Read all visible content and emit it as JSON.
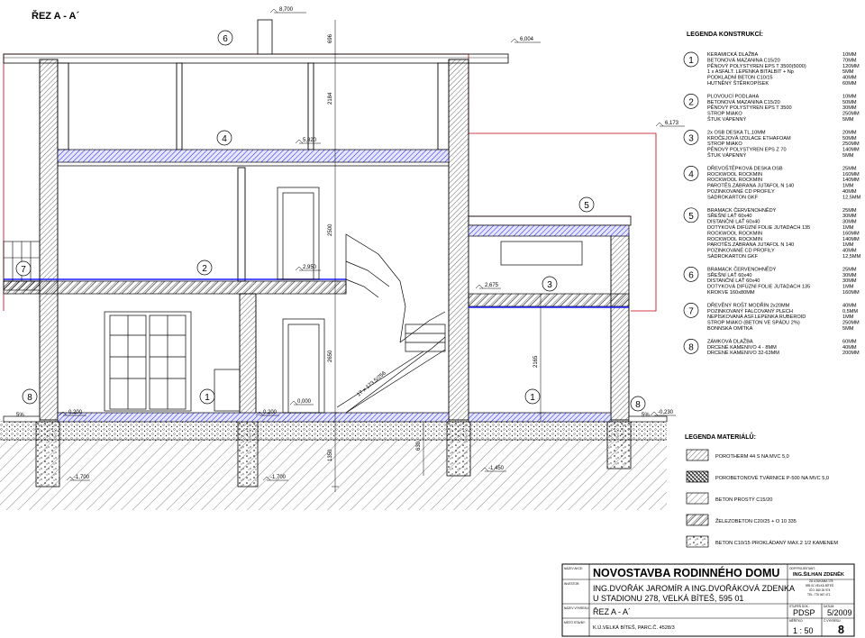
{
  "section": {
    "title": "ŘEZ  A - A´"
  },
  "levels": {
    "ridge": "8,700",
    "eave_top": "6,004",
    "side_roof": "6,173",
    "attic_floor": "5,820",
    "upper_floor": "2,950",
    "side_floor": "2,675",
    "ground": "0,000",
    "ground_left": "0,200",
    "ground_mid": "0,200",
    "terrain_right": "-0,230",
    "foot_left": "-1,700",
    "foot_mid": "-1,700",
    "foot_right": "-1,450"
  },
  "dims": {
    "d1": "696",
    "d2": "2184",
    "d3": "2500",
    "d4": "2650",
    "d5": "2165",
    "d6": "630",
    "d7": "1350",
    "stair": "17 x 173,5/256"
  },
  "slope": {
    "left": "5%",
    "right": "5%"
  },
  "section_markers": [
    "1",
    "2",
    "3",
    "4",
    "5",
    "6",
    "7",
    "8"
  ],
  "legend": {
    "title": "LEGENDA KONSTRUKCÍ:",
    "items": [
      {
        "num": "1",
        "lines": [
          {
            "name": "KERAMICKÁ DLAŽBA",
            "val": "10MM"
          },
          {
            "name": "BETONOVÁ MAZANINA  C15/20",
            "val": "70MM"
          },
          {
            "name": "PĚNOVÝ POLYSTYREN  EPS T 3500(5000)",
            "val": "120MM"
          },
          {
            "name": "1 x ASFALT. LEPENKA BITALBIT + Np",
            "val": "5MM"
          },
          {
            "name": "PODKLADNÍ BETON  C10/15",
            "val": "40MM"
          },
          {
            "name": "HUTNĚNÝ ŠTĚRKOPÍSEK",
            "val": "60MM"
          }
        ]
      },
      {
        "num": "2",
        "lines": [
          {
            "name": "PLOVOUCÍ PODLAHA",
            "val": "10MM"
          },
          {
            "name": "BETONOVÁ MAZANINA  C15/20",
            "val": "50MM"
          },
          {
            "name": "PĚNOVÝ POLYSTYREN  EPS T 3500",
            "val": "30MM"
          },
          {
            "name": "STROP MIAKO",
            "val": "250MM"
          },
          {
            "name": "ŠTUK VÁPENNÝ",
            "val": "5MM"
          }
        ]
      },
      {
        "num": "3",
        "lines": [
          {
            "name": "2x OSB DESKA TL.10MM",
            "val": "20MM"
          },
          {
            "name": "KROČEJOVÁ IZOLACE ETHAFOAM",
            "val": "50MM"
          },
          {
            "name": "STROP MIAKO",
            "val": "250MM"
          },
          {
            "name": "PĚNOVÝ POLYSTYREN  EPS Z 70",
            "val": "140MM"
          },
          {
            "name": "ŠTUK VÁPENNÝ",
            "val": "5MM"
          }
        ]
      },
      {
        "num": "4",
        "lines": [
          {
            "name": "DŘEVOŠTĚPKOVÁ DESKA OSB",
            "val": "25MM"
          },
          {
            "name": "ROCKWOOL ROCKMIN",
            "val": "160MM"
          },
          {
            "name": "ROCKWOOL ROCKMIN",
            "val": "140MM"
          },
          {
            "name": "PAROTĚS.ZÁBRANA JUTAFOL N 140",
            "val": "1MM"
          },
          {
            "name": "POZINKOVANÉ CD PROFILY",
            "val": "40MM"
          },
          {
            "name": "SÁDROKARTON GKF",
            "val": "12,5MM"
          }
        ]
      },
      {
        "num": "5",
        "lines": [
          {
            "name": "BRAMACK ČERVENOHNĚDÝ",
            "val": "25MM"
          },
          {
            "name": "SŘEŠNÍ LAŤ 60x40",
            "val": "30MM"
          },
          {
            "name": "DISTANČNÍ LAŤ 60x40",
            "val": "30MM"
          },
          {
            "name": "DOTYKOVÁ DIFÚZNÍ FOLIE JUTADACH 135",
            "val": "1MM"
          },
          {
            "name": "ROCKWOOL ROCKMIN",
            "val": "160MM"
          },
          {
            "name": "ROCKWOOL ROCKMIN",
            "val": "140MM"
          },
          {
            "name": "PAROTĚS.ZÁBRANA JUTAFOL N 140",
            "val": "1MM"
          },
          {
            "name": "POZINKOVANÉ CD PROFILY",
            "val": "40MM"
          },
          {
            "name": "SÁDROKARTON GKF",
            "val": "12,5MM"
          }
        ]
      },
      {
        "num": "6",
        "lines": [
          {
            "name": "BRAMACK ČERVENOHNĚDÝ",
            "val": "25MM"
          },
          {
            "name": "SŘEŠNÍ LAŤ 60x40",
            "val": "30MM"
          },
          {
            "name": "DISTANČNÍ LAŤ 60x40",
            "val": "30MM"
          },
          {
            "name": "DOTYKOVÁ DIFÚZNÍ FOLIE JUTADACH 135",
            "val": "1MM"
          },
          {
            "name": "KROKVE 160x80MM",
            "val": "160MM"
          }
        ]
      },
      {
        "num": "7",
        "lines": [
          {
            "name": "DŘEVĚNÝ ROŠT MODŘÍN 2x20MM",
            "val": "40MM"
          },
          {
            "name": "POZINKOVANÝ FALCOVANÝ PLECH",
            "val": "0,5MM"
          },
          {
            "name": "NEPÍSKOVANÁ ASF.LEPENKA RUBEROID",
            "val": "1MM"
          },
          {
            "name": "STROP MIAKO (BETON VE SPÁDU 2%)",
            "val": "250MM"
          },
          {
            "name": "BONNSKÁ OMÍTKA",
            "val": "5MM"
          }
        ]
      },
      {
        "num": "8",
        "lines": [
          {
            "name": "ZÁMKOVÁ DLAŽBA",
            "val": "60MM"
          },
          {
            "name": "DRCENÉ KAMENIVO  4 - 8MM",
            "val": "40MM"
          },
          {
            "name": "DRCENÉ KAMENIVO  32-63MM",
            "val": "200MM"
          }
        ]
      }
    ]
  },
  "materials": {
    "title": "LEGENDA MATERIÁLŮ:",
    "items": [
      {
        "label": "POROTHERM 44 S NA MVC 5,0",
        "pattern": "porotherm"
      },
      {
        "label": "POROBETONOVÉ TVÁRNICE P-500 NA MVC 5,0",
        "pattern": "porobeton"
      },
      {
        "label": "BETON PROSTÝ C15/20",
        "pattern": "beton"
      },
      {
        "label": "ŽELEZOBETON   C20/25 + O 10 335",
        "pattern": "zelezo"
      },
      {
        "label": "BETON C10/15 PROKLÁDANÝ MAX.2 1/2 KAMENEM",
        "pattern": "kamen"
      }
    ]
  },
  "title_block": {
    "label_project": "NÁZEV AKCE:",
    "project": "NOVOSTAVBA RODINNÉHO DOMU",
    "label_investor": "INVESTOR:",
    "investor_line1": "ING.DVOŘÁK JAROMÍR A ING.DVOŘÁKOVÁ ZDENKA",
    "investor_line2": "U STADIONU 278, VELKÁ BÍTEŠ, 595 01",
    "label_drawing": "NÁZEV VÝKRESU:",
    "drawing": "ŘEZ  A - A´",
    "label_place": "MÍSTO STAVBY:",
    "place": "K.Ú.VELKÁ BÍTEŠ, PARC.Č. 4528/3",
    "label_designer": "ODP.PROJEKTANT:",
    "designer": "ING.ŠILHAN ZDENĚK",
    "designer_addr1": "ZA LOUKAMA 178",
    "designer_addr2": "595 01  VELKÁ BÍTEŠ",
    "designer_ico": "IČO: 460 26 974",
    "designer_tel": "TEL: 776 067 471",
    "label_stage": "STUPEŇ DOK.:",
    "stage": "PDSP",
    "label_date": "DATUM:",
    "date": "5/2009",
    "label_scale": "MĚŘÍTKO:",
    "scale": "1 : 50",
    "label_sheet": "Č.VÝKRESU:",
    "sheet": "8"
  },
  "colors": {
    "line": "#000000",
    "roof": "#c0000b",
    "insulation": "#1a1aff",
    "dim": "#000000"
  }
}
